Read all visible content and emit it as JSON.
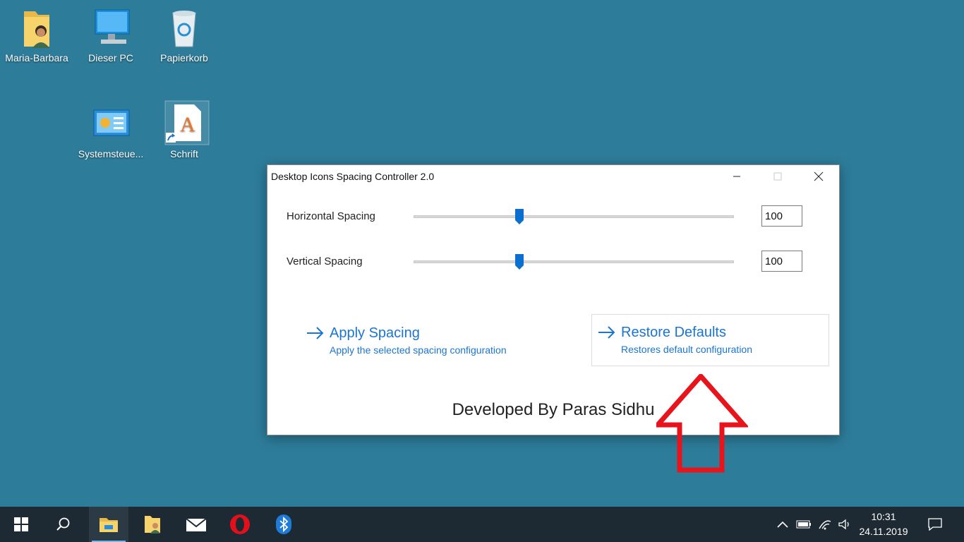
{
  "desktop": {
    "icons": [
      {
        "label": "Maria-Barbara",
        "icon": "user-folder-icon"
      },
      {
        "label": "Dieser PC",
        "icon": "computer-icon"
      },
      {
        "label": "Papierkorb",
        "icon": "recycle-bin-icon"
      },
      {
        "label": "Systemsteue...",
        "icon": "control-panel-icon"
      },
      {
        "label": "Schrift",
        "icon": "font-file-shortcut-icon"
      }
    ]
  },
  "window": {
    "title": "Desktop Icons Spacing Controller 2.0",
    "controls": {
      "minimize": "minimize-icon",
      "maximize": "maximize-icon",
      "close": "close-icon"
    },
    "horizontal": {
      "label": "Horizontal Spacing",
      "value": "100",
      "slider_fraction": 0.33
    },
    "vertical": {
      "label": "Vertical Spacing",
      "value": "100",
      "slider_fraction": 0.33
    },
    "apply": {
      "title": "Apply Spacing",
      "subtitle": "Apply the selected spacing configuration"
    },
    "restore": {
      "title": "Restore Defaults",
      "subtitle": "Restores default configuration"
    },
    "footer": "Developed By Paras Sidhu"
  },
  "annotation": {
    "color": "#e8141c",
    "icon": "red-up-arrow-annotation"
  },
  "taskbar": {
    "items": [
      {
        "name": "start-button",
        "icon": "windows-logo-icon"
      },
      {
        "name": "search-button",
        "icon": "search-icon"
      },
      {
        "name": "file-explorer-button",
        "icon": "file-explorer-icon"
      },
      {
        "name": "user-files-button",
        "icon": "user-folder-icon"
      },
      {
        "name": "mail-button",
        "icon": "mail-icon"
      },
      {
        "name": "opera-button",
        "icon": "opera-icon"
      },
      {
        "name": "bluetooth-button",
        "icon": "bluetooth-icon"
      }
    ],
    "tray": {
      "icons": [
        "chevron-up-icon",
        "battery-icon",
        "wifi-icon",
        "volume-icon"
      ],
      "time": "10:31",
      "date": "24.11.2019",
      "notification_icon": "notification-icon"
    }
  },
  "colors": {
    "desktop": "#2d7c9a",
    "accent": "#1a75d2",
    "taskbar": "#1d2a33"
  }
}
